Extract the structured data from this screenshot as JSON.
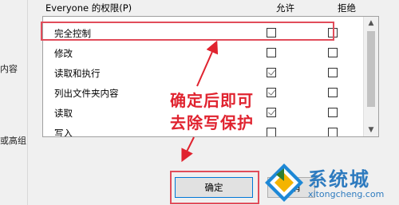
{
  "background_window": {
    "left_fragments": [
      "内容",
      "或高组"
    ]
  },
  "permissions": {
    "title": "Everyone 的权限(P)",
    "allow_header": "允许",
    "deny_header": "拒绝",
    "rows": [
      {
        "name": "完全控制",
        "allow": false,
        "deny": false
      },
      {
        "name": "修改",
        "allow": false,
        "deny": false
      },
      {
        "name": "读取和执行",
        "allow": true,
        "deny": false
      },
      {
        "name": "列出文件夹内容",
        "allow": true,
        "deny": false
      },
      {
        "name": "读取",
        "allow": true,
        "deny": false
      },
      {
        "name": "写入",
        "allow": false,
        "deny": false
      }
    ]
  },
  "buttons": {
    "ok": "确定",
    "cancel": "取消"
  },
  "annotation": {
    "line1": "确定后即可",
    "line2": "去除写保护",
    "color": "#e0232f"
  },
  "watermark": {
    "brand": "系统城",
    "url": "xitongcheng.com"
  }
}
